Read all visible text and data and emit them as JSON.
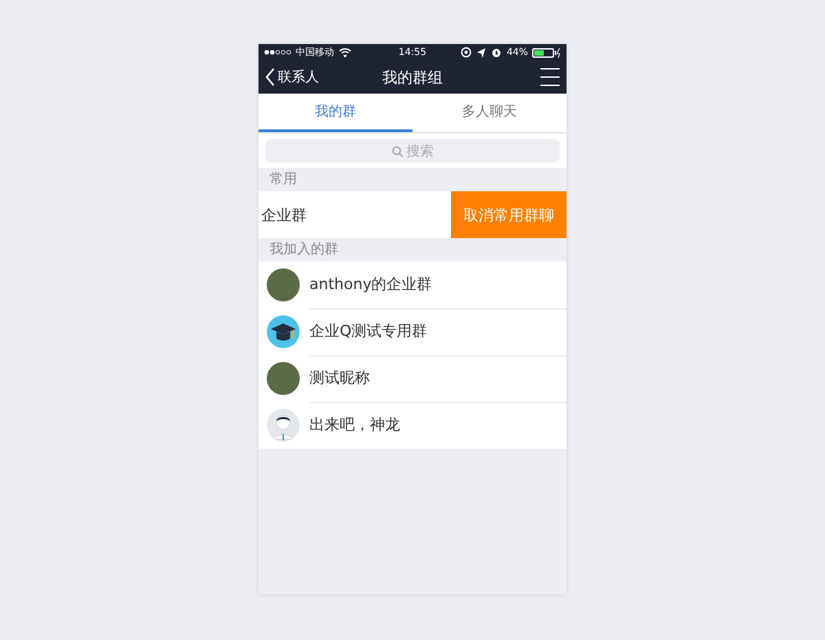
{
  "status_bar": {
    "carrier": "中国移动",
    "time": "14:55",
    "battery": "44%"
  },
  "nav": {
    "back": "联系人",
    "title": "我的群组"
  },
  "tabs": [
    {
      "label": "我的群",
      "selected": true
    },
    {
      "label": "多人聊天",
      "selected": false
    }
  ],
  "search": {
    "placeholder": "搜索"
  },
  "sections": [
    {
      "title": "常用",
      "rows": [
        {
          "name": "企业群",
          "kind": "swiped",
          "action": "取消常用群聊"
        }
      ]
    },
    {
      "title": "我加入的群",
      "rows": [
        {
          "name": "anthony的企业群",
          "kind": "photo"
        },
        {
          "name": "企业Q测试专用群",
          "kind": "cap"
        },
        {
          "name": "测试昵称",
          "kind": "photo"
        },
        {
          "name": "出来吧，神龙",
          "kind": "person"
        }
      ]
    }
  ]
}
